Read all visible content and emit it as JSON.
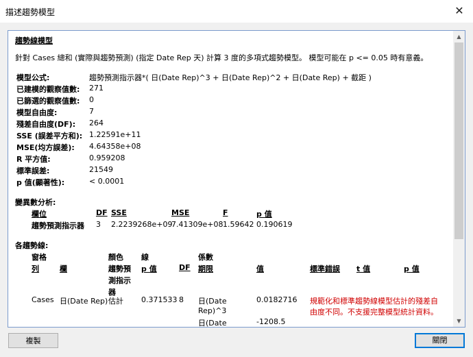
{
  "window": {
    "title": "描述趨勢模型",
    "close_glyph": "✕"
  },
  "report": {
    "heading": "趨勢線模型",
    "intro": "針對 Cases 總和 (實際與趨勢預測) (指定 Date Rep 天) 計算 3 度的多項式趨勢模型。 模型可能在 p <= 0.05 時有意義。",
    "stats": [
      {
        "label": "模型公式:",
        "value": "趨勢預測指示器*( 日(Date Rep)^3 + 日(Date Rep)^2 + 日(Date Rep) + 截距 )"
      },
      {
        "label": "已建模的觀察值數:",
        "value": "271"
      },
      {
        "label": "已篩選的觀察值數:",
        "value": "0"
      },
      {
        "label": "模型自由度:",
        "value": "7"
      },
      {
        "label": "殘差自由度(DF):",
        "value": "264"
      },
      {
        "label": "SSE (誤差平方和):",
        "value": "1.22591e+11"
      },
      {
        "label": "MSE(均方誤差):",
        "value": "4.64358e+08"
      },
      {
        "label": "R 平方值:",
        "value": "0.959208"
      },
      {
        "label": "標準誤差:",
        "value": "21549"
      },
      {
        "label": "p 值(顯著性):",
        "value": "< 0.0001"
      }
    ],
    "anova": {
      "heading": "變異數分析:",
      "headers": {
        "field": "欄位",
        "df": "DF",
        "sse": "SSE",
        "mse": "MSE",
        "f": "F",
        "p": "p 值"
      },
      "row": {
        "field": "趨勢預測指示器",
        "df": "3",
        "sse": "2.2239268e+09",
        "mse": "7.41309e+08",
        "f": "1.59642",
        "p": "0.190619"
      }
    },
    "lines": {
      "heading": "各趨勢線:",
      "headers": {
        "pane": "窗格",
        "row": "列",
        "col": "欄",
        "color": "顏色",
        "color_sub1": "趨勢預",
        "color_sub2": "測指示",
        "color_sub3": "器",
        "line": "線",
        "p": "p 值",
        "df": "DF",
        "coef": "係數",
        "term": "期限",
        "value": "值",
        "stderr": "標準錯誤",
        "t": "t 值",
        "cp": "p 值"
      },
      "row1": {
        "row": "Cases",
        "col": "日(Date Rep)",
        "color": "估計",
        "p": "0.371533",
        "df": "8",
        "term_line1": "日(Date",
        "term_line2": "Rep)^3",
        "value": "0.0182716",
        "note_line1": "規範化和標準趨勢線模型估計的殘差自",
        "note_line2": "由度不同。不支援完整模型統計資料。"
      },
      "row2": {
        "term_line1": "日(Date",
        "value": "-1208.5"
      }
    }
  },
  "buttons": {
    "copy": "複製",
    "close": "關閉"
  }
}
